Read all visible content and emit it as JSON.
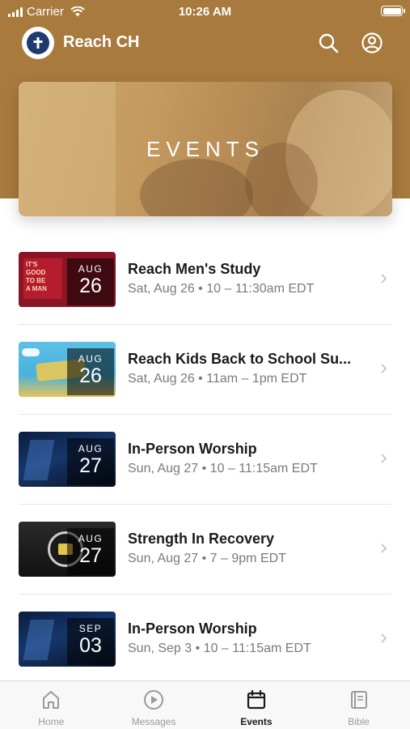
{
  "status_bar": {
    "carrier": "Carrier",
    "time": "10:26 AM"
  },
  "app_bar": {
    "title": "Reach CH",
    "logo_icon": "cross-icon",
    "search_icon": "search-icon",
    "profile_icon": "profile-icon"
  },
  "hero": {
    "title": "EVENTS"
  },
  "events": [
    {
      "title": "Reach Men's Study",
      "subtitle": "Sat, Aug 26 • 10 – 11:30am EDT",
      "month": "AUG",
      "day": "26"
    },
    {
      "title": "Reach Kids Back to School Su...",
      "subtitle": "Sat, Aug 26 • 11am – 1pm EDT",
      "month": "AUG",
      "day": "26"
    },
    {
      "title": "In-Person Worship",
      "subtitle": "Sun, Aug 27 • 10 – 11:15am EDT",
      "month": "AUG",
      "day": "27"
    },
    {
      "title": "Strength In Recovery",
      "subtitle": "Sun, Aug 27 • 7 – 9pm EDT",
      "month": "AUG",
      "day": "27"
    },
    {
      "title": "In-Person Worship",
      "subtitle": "Sun, Sep 3 • 10 – 11:15am EDT",
      "month": "SEP",
      "day": "03"
    }
  ],
  "thumb_text": {
    "mens_study_lines": [
      "IT'S",
      "GOOD",
      "TO BE",
      "A MAN"
    ]
  },
  "tabs": [
    {
      "label": "Home",
      "icon": "home-icon"
    },
    {
      "label": "Messages",
      "icon": "play-icon"
    },
    {
      "label": "Events",
      "icon": "calendar-icon",
      "active": true
    },
    {
      "label": "Bible",
      "icon": "book-icon"
    }
  ],
  "colors": {
    "brand": "#a87a3e",
    "text_primary": "#1a1a1a",
    "text_secondary": "#7a7a7a"
  }
}
